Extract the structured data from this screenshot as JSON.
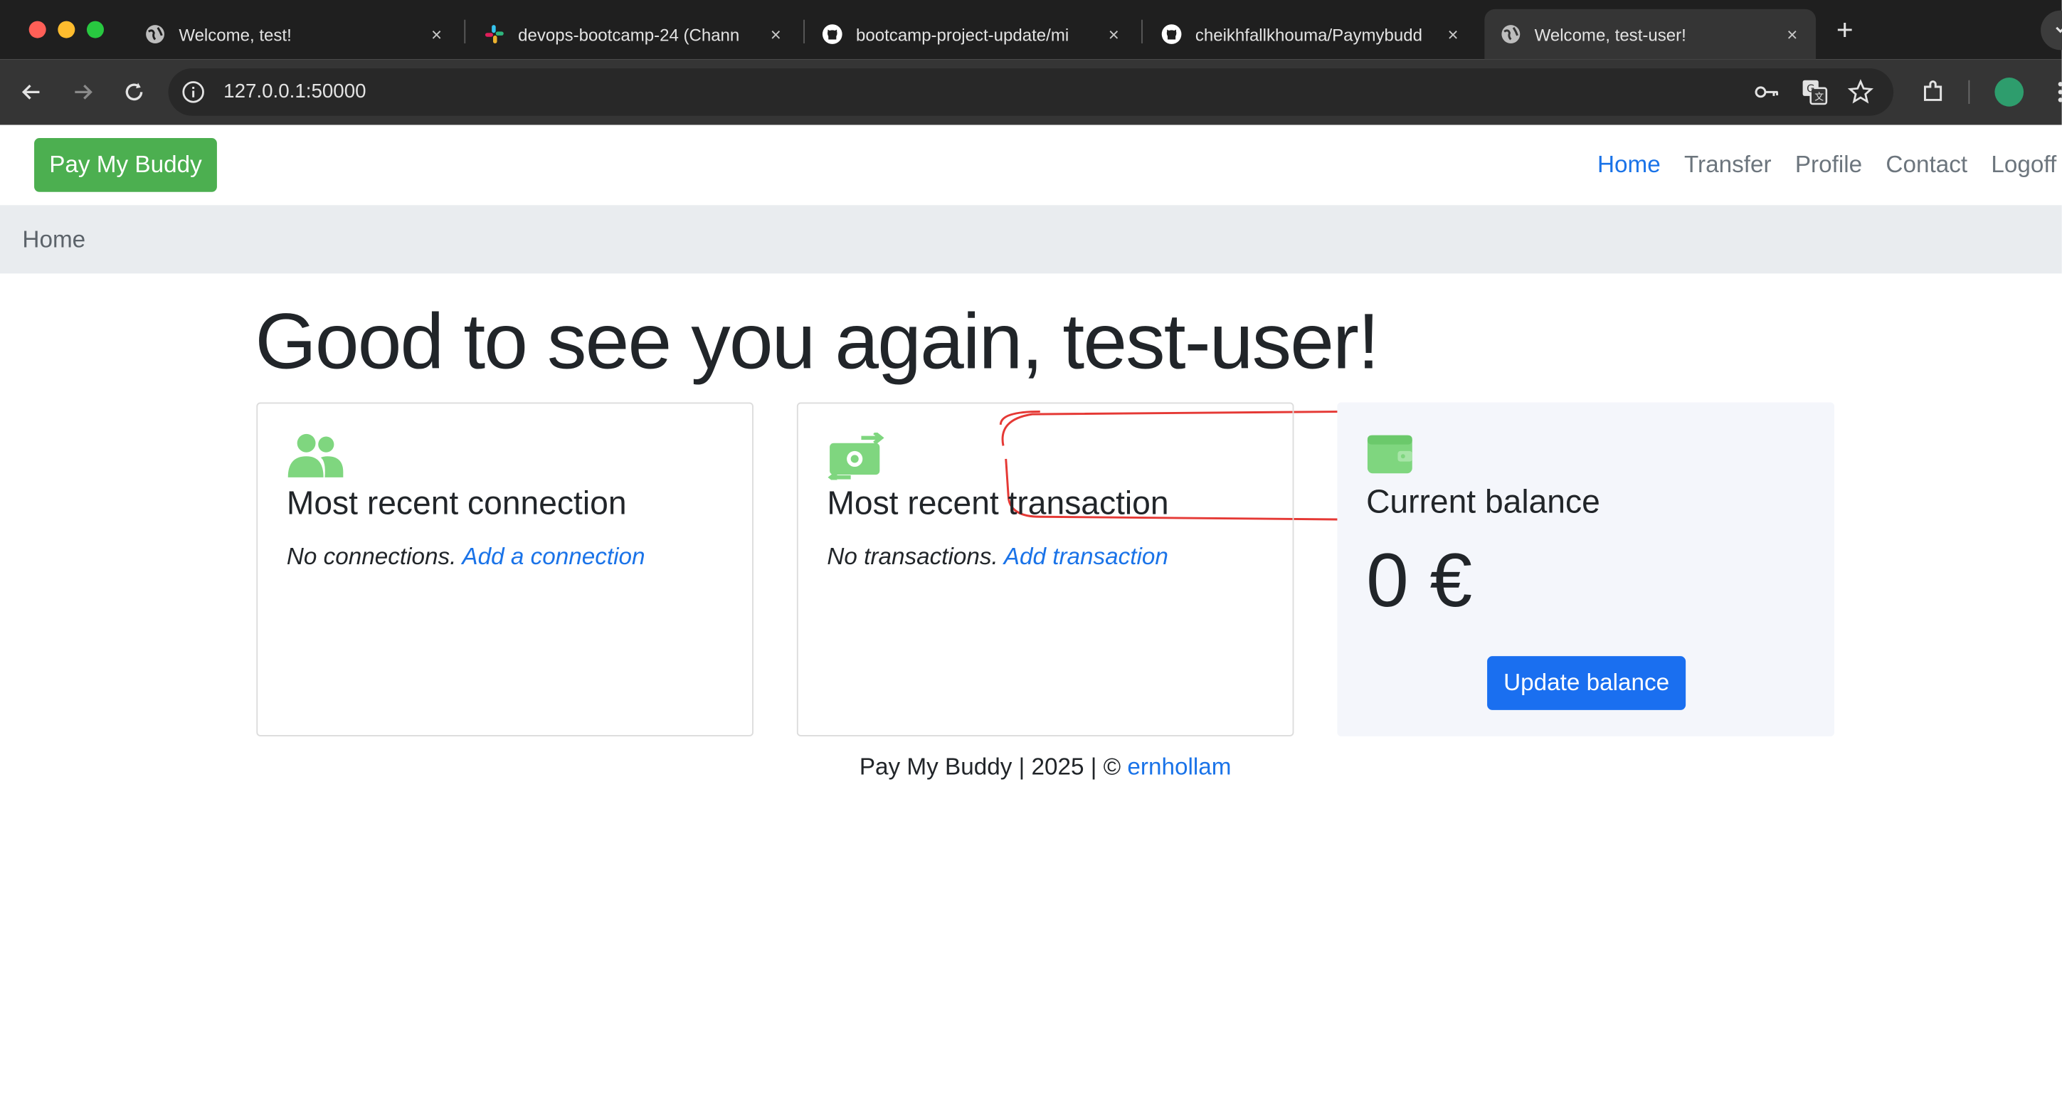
{
  "browser": {
    "tabs": [
      {
        "title": "Welcome, test!",
        "icon": "globe-icon",
        "active": false
      },
      {
        "title": "devops-bootcamp-24 (Chann",
        "icon": "slack-icon",
        "active": false
      },
      {
        "title": "bootcamp-project-update/mi",
        "icon": "github-icon",
        "active": false
      },
      {
        "title": "cheikhfallkhouma/Paymybudd",
        "icon": "github-icon",
        "active": false
      },
      {
        "title": "Welcome, test-user!",
        "icon": "globe-icon",
        "active": true
      }
    ],
    "new_tab_label": "+",
    "tab_close_glyph": "×",
    "address": "127.0.0.1:50000",
    "colors": {
      "chrome_dark": "#1f1f1f",
      "toolbar": "#353535",
      "profile_dot": "#2e9d6d"
    }
  },
  "app": {
    "brand": "Pay My Buddy",
    "nav": [
      {
        "label": "Home",
        "active": true
      },
      {
        "label": "Transfer",
        "active": false
      },
      {
        "label": "Profile",
        "active": false
      },
      {
        "label": "Contact",
        "active": false
      },
      {
        "label": "Logoff",
        "active": false
      }
    ],
    "breadcrumb": "Home",
    "greeting": "Good to see you again, test-user!",
    "colors": {
      "brand_green": "#4caf50",
      "icon_green": "#7fd67f",
      "link_blue": "#1a73e8",
      "primary_button": "#1a6ff0",
      "annotation_red": "#e53935"
    }
  },
  "cards": {
    "connection": {
      "icon": "users-icon",
      "title": "Most recent connection",
      "empty_text": "No connections.",
      "link": "Add a connection"
    },
    "transaction": {
      "icon": "money-transfer-icon",
      "title": "Most recent transaction",
      "empty_text": "No transactions.",
      "link": "Add transaction"
    },
    "balance": {
      "icon": "wallet-icon",
      "title": "Current balance",
      "amount": "0 €",
      "button": "Update balance"
    }
  },
  "footer": {
    "text": "Pay My Buddy | 2025 | ©",
    "author": "ernhollam"
  }
}
